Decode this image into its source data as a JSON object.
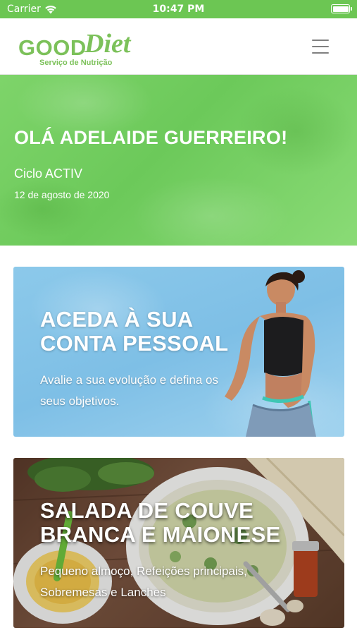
{
  "status_bar": {
    "carrier": "Carrier",
    "time": "10:47 PM"
  },
  "header": {
    "logo": {
      "word1": "GOOD",
      "word2": "Diet",
      "tagline": "Serviço de Nutrição"
    },
    "menu_icon": "hamburger-menu-icon"
  },
  "greeting": {
    "title": "OLÁ ADELAIDE GUERREIRO!",
    "plan": "Ciclo ACTIV",
    "date": "12 de agosto de 2020"
  },
  "cards": [
    {
      "title": "ACEDA À SUA CONTA PESSOAL",
      "description": "Avalie a sua evolução e defina os seus objetivos."
    },
    {
      "title": "SALADA DE COUVE BRANCA E MAIONESE",
      "description": "Pequeno almoço, Refeições principais, Sobremesas e Lanches"
    }
  ],
  "colors": {
    "status_bar": "#6cc653",
    "brand_green": "#7cc15a",
    "hero_green": "#74cf61",
    "account_card_blue": "#86c5e8",
    "text_white": "#ffffff"
  }
}
